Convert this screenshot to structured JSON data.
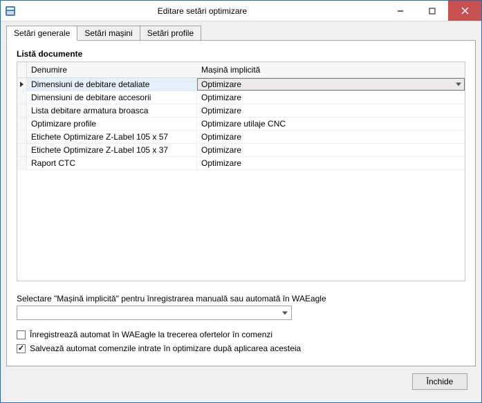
{
  "window": {
    "title": "Editare setări optimizare"
  },
  "tabs": {
    "general": "Setări generale",
    "machines": "Setări mașini",
    "profiles": "Setări profile"
  },
  "list": {
    "title": "Listă documente",
    "headers": {
      "name": "Denumire",
      "machine": "Mașină implicită"
    },
    "rows": [
      {
        "name": "Dimensiuni de debitare detaliate",
        "machine": "Optimizare",
        "selected": true
      },
      {
        "name": "Dimensiuni de debitare accesorii",
        "machine": "Optimizare"
      },
      {
        "name": "Lista debitare armatura broasca",
        "machine": "Optimizare"
      },
      {
        "name": "Optimizare profile",
        "machine": "Optimizare utilaje CNC"
      },
      {
        "name": "Etichete Optimizare Z-Label 105 x 57",
        "machine": "Optimizare"
      },
      {
        "name": "Etichete Optimizare Z-Label 105 x 37",
        "machine": "Optimizare"
      },
      {
        "name": "Raport CTC",
        "machine": "Optimizare"
      }
    ]
  },
  "lower": {
    "hint": "Selectare \"Mașină implicită\" pentru înregistrarea manuală sau automată în WAEagle",
    "combo_value": "",
    "checkbox1": {
      "label": "Înregistrează automat în WAEagle la trecerea ofertelor în comenzi",
      "checked": false
    },
    "checkbox2": {
      "label": "Salvează automat comenzile intrate în optimizare după aplicarea acesteia",
      "checked": true
    }
  },
  "footer": {
    "close": "Închide"
  }
}
